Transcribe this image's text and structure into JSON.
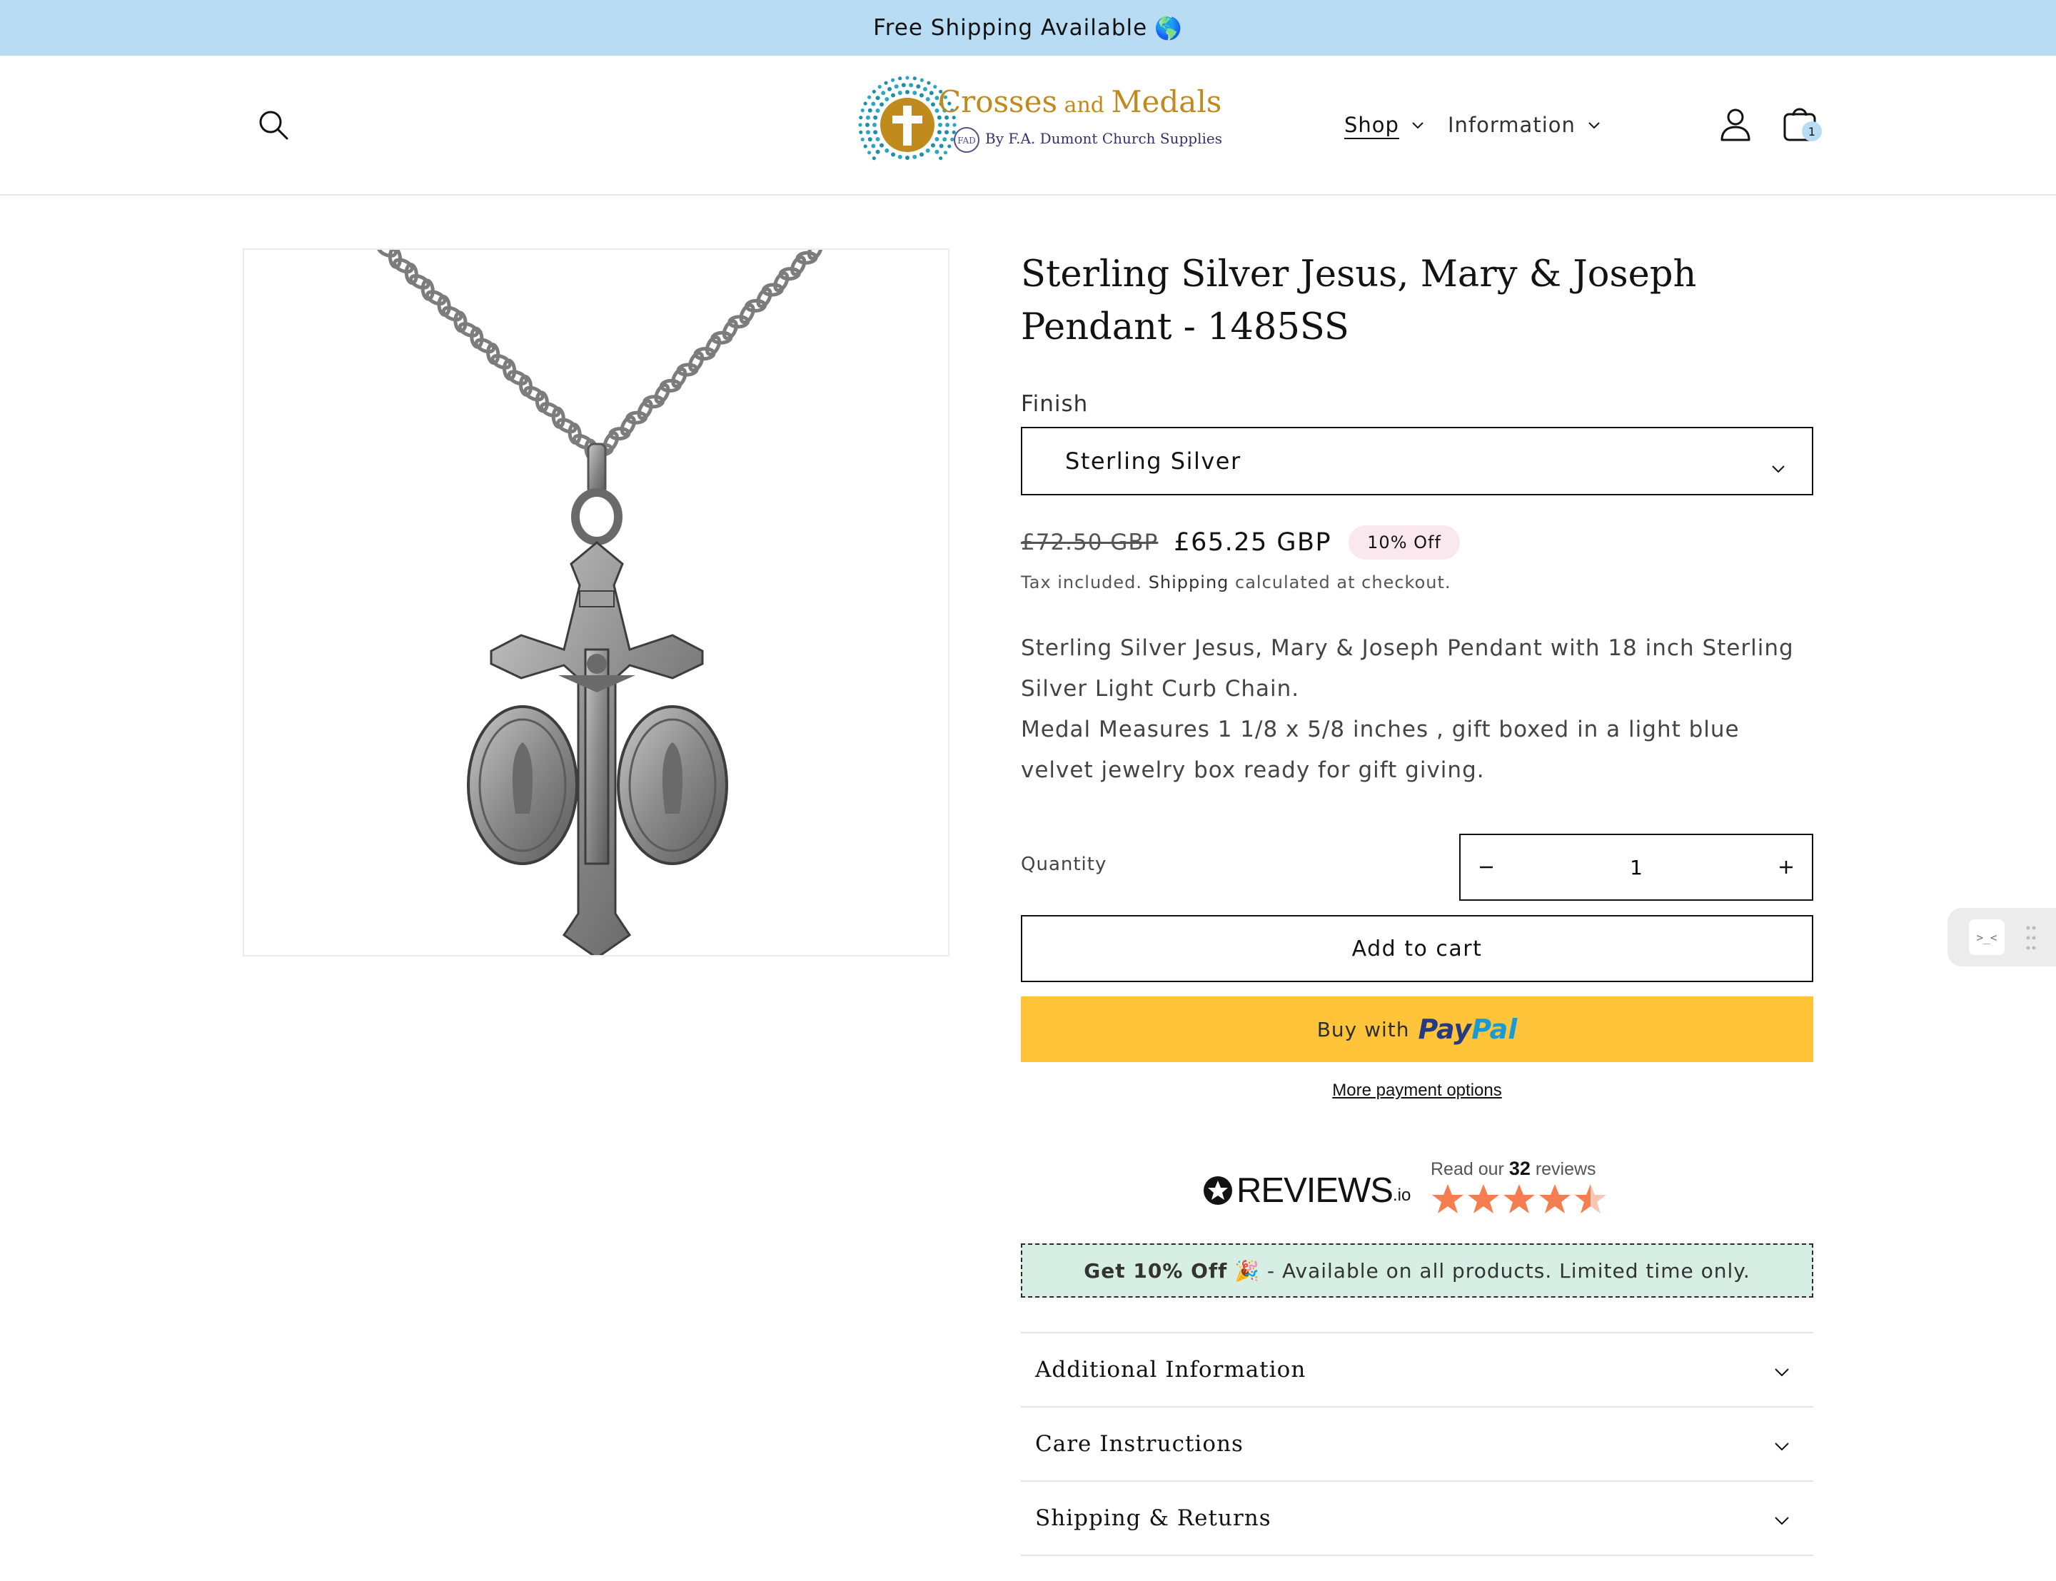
{
  "announcement": {
    "text": "Free Shipping Available",
    "emoji": "🌎"
  },
  "header": {
    "logo": {
      "word_main": "Crosses",
      "word_and": "and",
      "word_end": "Medals",
      "sub": "By F.A. Dumont Church Supplies",
      "monogram": "FAD"
    },
    "nav": [
      {
        "label": "Shop",
        "active": true
      },
      {
        "label": "Information",
        "active": false
      }
    ],
    "cart_count": "1"
  },
  "product": {
    "title": "Sterling Silver Jesus, Mary & Joseph Pendant - 1485SS",
    "finish_label": "Finish",
    "finish_value": "Sterling Silver",
    "old_price": "£72.50 GBP",
    "new_price": "£65.25 GBP",
    "discount_badge": "10% Off",
    "tax_prefix": "Tax included.",
    "tax_link": "Shipping",
    "tax_suffix": "calculated at checkout.",
    "description_1": "Sterling Silver Jesus, Mary & Joseph Pendant with 18 inch Sterling Silver Light Curb Chain.",
    "description_2": "Medal Measures 1 1/8 x 5/8 inches , gift boxed in a light blue velvet jewelry box ready for gift giving.",
    "quantity_label": "Quantity",
    "quantity_value": "1",
    "add_to_cart": "Add to cart",
    "paypal_prefix": "Buy with",
    "paypal_a": "Pay",
    "paypal_b": "Pal",
    "more_payment": "More payment options"
  },
  "reviews": {
    "brand": "REVIEWS",
    "brand_suffix": ".io",
    "read_prefix": "Read our",
    "count": "32",
    "read_suffix": "reviews",
    "rating": 4.5,
    "star_color": "#f47e4f"
  },
  "promo": {
    "bold": "Get 10% Off",
    "emoji": "🎉",
    "text": "- Available on all products. Limited time only."
  },
  "accordion": [
    {
      "label": "Additional Information"
    },
    {
      "label": "Care Instructions"
    },
    {
      "label": "Shipping & Returns"
    }
  ],
  "widget": {
    "glyph": ">_<"
  },
  "colors": {
    "announcement_bg": "#b8dcf4",
    "paypal_bg": "#ffc439",
    "promo_bg": "#d6eee3",
    "brand_gold": "#c08a1d"
  }
}
